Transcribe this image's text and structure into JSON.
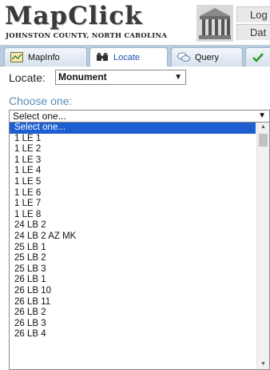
{
  "header": {
    "title": "MapClick",
    "subtitle": "JOHNSTON COUNTY, NORTH CAROLINA",
    "link1": "Log",
    "link2": "Dat"
  },
  "tabs": [
    {
      "label": "MapInfo",
      "icon": "map-icon"
    },
    {
      "label": "Locate",
      "icon": "binoculars-icon"
    },
    {
      "label": "Query",
      "icon": "speech-bubbles-icon"
    },
    {
      "label": "",
      "icon": "checkmark-icon"
    }
  ],
  "locate": {
    "label": "Locate:",
    "selected": "Monument"
  },
  "choose": {
    "label": "Choose one:",
    "selected": "Select one...",
    "options": [
      "Select one...",
      "1 LE 1",
      "1 LE 2",
      "1 LE 3",
      "1 LE 4",
      "1 LE 5",
      "1 LE 6",
      "1 LE 7",
      "1 LE 8",
      "24 LB 2",
      "24 LB 2 AZ MK",
      "25 LB 1",
      "25 LB 2",
      "25 LB 3",
      "26 LB 1",
      "26 LB 10",
      "26 LB 11",
      "26 LB 2",
      "26 LB 3",
      "26 LB 4"
    ]
  },
  "colors": {
    "tabbar": "#b9cde0",
    "active_tab_text": "#1a4fb8",
    "choose_label": "#5b8fb8",
    "selection": "#1d5fd1"
  }
}
